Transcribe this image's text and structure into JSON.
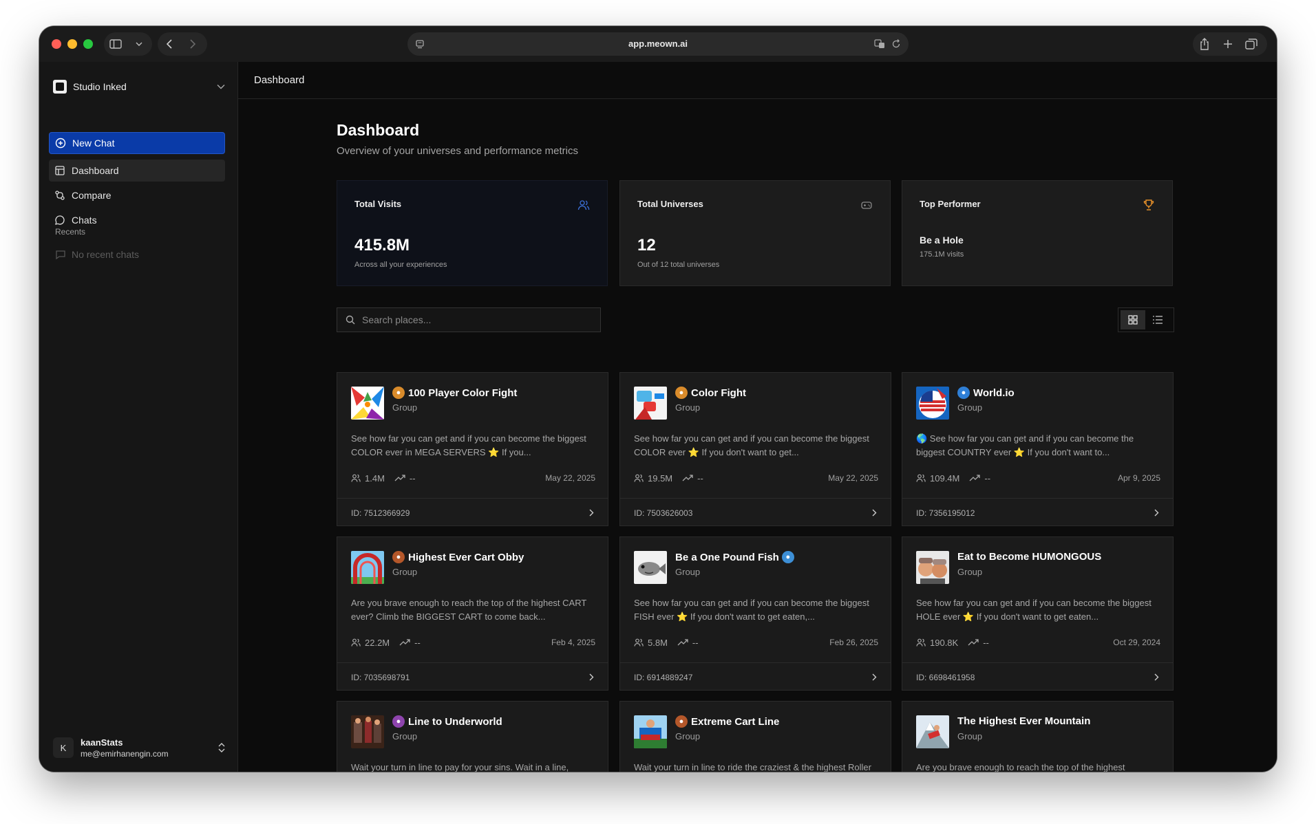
{
  "browser": {
    "url": "app.meown.ai"
  },
  "sidebar": {
    "org_name": "Studio Inked",
    "nav": {
      "new_chat": "New Chat",
      "dashboard": "Dashboard",
      "compare": "Compare",
      "chats": "Chats"
    },
    "recents_label": "Recents",
    "no_recent": "No recent chats",
    "user": {
      "initial": "K",
      "name": "kaanStats",
      "email": "me@emirhanengin.com"
    }
  },
  "main": {
    "header_title": "Dashboard",
    "page_title": "Dashboard",
    "page_subtitle": "Overview of your universes and performance metrics",
    "stats": [
      {
        "label": "Total Visits",
        "value": "415.8M",
        "note": "Across all your experiences",
        "icon": "users-icon",
        "color": "#3b6fd6"
      },
      {
        "label": "Total Universes",
        "value": "12",
        "note": "Out of 12 total universes",
        "icon": "gamepad-icon",
        "color": "#8a8a8a"
      },
      {
        "label": "Top Performer",
        "value": "Be a Hole",
        "note": "175.1M visits",
        "icon": "trophy-icon",
        "color": "#e8912a"
      }
    ],
    "search_placeholder": "Search places...",
    "cards": [
      {
        "title": "100 Player Color Fight",
        "emoji": "palette",
        "type": "Group",
        "desc": "See how far you can get and if you can become the biggest COLOR ever in MEGA SERVERS ⭐ If you...",
        "visits": "1.4M",
        "trend": "--",
        "date": "May 22, 2025",
        "id": "ID: 7512366929"
      },
      {
        "title": "Color Fight",
        "emoji": "palette",
        "type": "Group",
        "desc": "See how far you can get and if you can become the biggest COLOR ever ⭐ If you don't want to get...",
        "visits": "19.5M",
        "trend": "--",
        "date": "May 22, 2025",
        "id": "ID: 7503626003"
      },
      {
        "title": "World.io",
        "emoji": "globe",
        "type": "Group",
        "desc": "🌎 See how far you can get and if you can become the biggest COUNTRY ever ⭐ If you don't want to...",
        "visits": "109.4M",
        "trend": "--",
        "date": "Apr 9, 2025",
        "id": "ID: 7356195012"
      },
      {
        "title": "Highest Ever Cart Obby",
        "emoji": "rollercoaster",
        "type": "Group",
        "desc": "Are you brave enough to reach the top of the highest CART ever? Climb the BIGGEST CART to come back...",
        "visits": "22.2M",
        "trend": "--",
        "date": "Feb 4, 2025",
        "id": "ID: 7035698791"
      },
      {
        "title": "Be a One Pound Fish",
        "emoji": "fish",
        "type": "Group",
        "desc": "See how far you can get and if you can become the biggest FISH ever ⭐ If you don't want to get eaten,...",
        "visits": "5.8M",
        "trend": "--",
        "date": "Feb 26, 2025",
        "id": "ID: 6914889247"
      },
      {
        "title": "Eat to Become HUMONGOUS",
        "emoji": "",
        "type": "Group",
        "desc": "See how far you can get and if you can become the biggest HOLE ever ⭐ If you don't want to get eaten...",
        "visits": "190.8K",
        "trend": "--",
        "date": "Oct 29, 2024",
        "id": "ID: 6698461958"
      },
      {
        "title": "Line to Underworld",
        "emoji": "devil",
        "type": "Group",
        "desc": "Wait your turn in line to pay for your sins. Wait in a line, Purchase upgrades as you wait and try to enjoy your...",
        "visits": "",
        "trend": "",
        "date": "",
        "id": ""
      },
      {
        "title": "Extreme Cart Line",
        "emoji": "rollercoaster",
        "type": "Group",
        "desc": "Wait your turn in line to ride the craziest & the highest Roller Coaster ever. Wait in a line, Purchase upgrade...",
        "visits": "",
        "trend": "",
        "date": "",
        "id": ""
      },
      {
        "title": "The Highest Ever Mountain",
        "emoji": "",
        "type": "Group",
        "desc": "Are you brave enough to reach the top of the highest MOUNTAIN ever? Climb the BIGGEST MOUNTAIN to...",
        "visits": "",
        "trend": "",
        "date": "",
        "id": ""
      }
    ]
  }
}
